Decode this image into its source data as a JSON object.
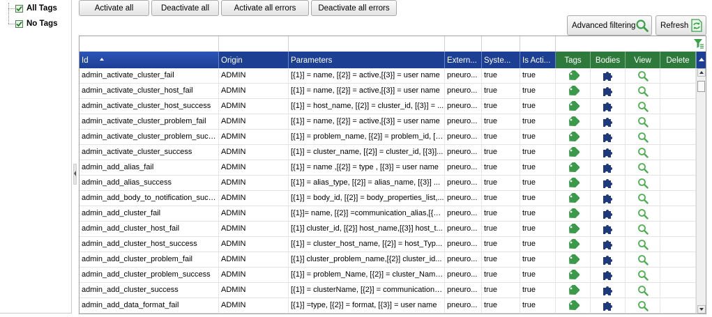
{
  "tree": {
    "items": [
      {
        "label": "All Tags",
        "checked": true
      },
      {
        "label": "No Tags",
        "checked": true
      }
    ]
  },
  "toolbar": {
    "activate_all": "Activate all",
    "deactivate_all": "Deactivate all",
    "activate_all_errors": "Activate all errors",
    "deactivate_all_errors": "Deactivate all errors",
    "advanced_filtering": "Advanced filtering",
    "refresh": "Refresh"
  },
  "grid": {
    "columns": {
      "id": "Id",
      "origin": "Origin",
      "parameters": "Parameters",
      "external": "Extern...",
      "system": "Syste...",
      "is_active": "Is Acti...",
      "tags": "Tags",
      "bodies": "Bodies",
      "view": "View",
      "delete": "Delete"
    },
    "sort_column": "id",
    "sort_direction": "ascending",
    "rows": [
      {
        "id": "admin_activate_cluster_fail",
        "origin": "ADMIN",
        "parameters": "[{1}] = name, [{2}] = active,[{3}] = user name",
        "external": "pneuro...",
        "system": "true",
        "active": "true"
      },
      {
        "id": "admin_activate_cluster_host_fail",
        "origin": "ADMIN",
        "parameters": "[{1}] = name, [{2}] = active,[{3}] = user name",
        "external": "pneuro...",
        "system": "true",
        "active": "true"
      },
      {
        "id": "admin_activate_cluster_host_success",
        "origin": "ADMIN",
        "parameters": "[{1}] = host_name, [{2}] = cluster_id, [{3}] = ...",
        "external": "pneuro...",
        "system": "true",
        "active": "true"
      },
      {
        "id": "admin_activate_cluster_problem_fail",
        "origin": "ADMIN",
        "parameters": "[{1}] = name, [{2}] = active,[{3}] = user name",
        "external": "pneuro...",
        "system": "true",
        "active": "true"
      },
      {
        "id": "admin_activate_cluster_problem_succ...",
        "origin": "ADMIN",
        "parameters": "[{1}] = problem_name, [{2}] = problem_id, [{...",
        "external": "pneuro...",
        "system": "true",
        "active": "true"
      },
      {
        "id": "admin_activate_cluster_success",
        "origin": "ADMIN",
        "parameters": "[{1}] = cluster_name, [{2}] = cluster_id, [{3}]...",
        "external": "pneuro...",
        "system": "true",
        "active": "true"
      },
      {
        "id": "admin_add_alias_fail",
        "origin": "ADMIN",
        "parameters": "[{1}] = name ,[{2}] = type , [{3}] =  user name",
        "external": "pneuro...",
        "system": "true",
        "active": "true"
      },
      {
        "id": "admin_add_alias_success",
        "origin": "ADMIN",
        "parameters": "[{1}] = alias_type, [{2}] = alias_name,  [{3}]  ...",
        "external": "pneuro...",
        "system": "true",
        "active": "true"
      },
      {
        "id": "admin_add_body_to_notification_succ...",
        "origin": "ADMIN",
        "parameters": "[{1}] = body_id, [{2}] = body_properties_list,...",
        "external": "pneuro...",
        "system": "true",
        "active": "true"
      },
      {
        "id": "admin_add_cluster_fail",
        "origin": "ADMIN",
        "parameters": "[{1}]= name, [{2}] =communication_alias,[{3}...",
        "external": "pneuro...",
        "system": "true",
        "active": "true"
      },
      {
        "id": "admin_add_cluster_host_fail",
        "origin": "ADMIN",
        "parameters": "[{1}] cluster_id, [{2}] host_name,[{3}] host_t...",
        "external": "pneuro...",
        "system": "true",
        "active": "true"
      },
      {
        "id": "admin_add_cluster_host_success",
        "origin": "ADMIN",
        "parameters": "[{1}] = cluster_host_name, [{2}] = host_Typ...",
        "external": "pneuro...",
        "system": "true",
        "active": "true"
      },
      {
        "id": "admin_add_cluster_problem_fail",
        "origin": "ADMIN",
        "parameters": "[{1}] cluster_problem_name,[{2}]  cluster_id...",
        "external": "pneuro...",
        "system": "true",
        "active": "true"
      },
      {
        "id": "admin_add_cluster_problem_success",
        "origin": "ADMIN",
        "parameters": "[{1}] = problem_Name, [{2}] = cluster_Name,...",
        "external": "pneuro...",
        "system": "true",
        "active": "true"
      },
      {
        "id": "admin_add_cluster_success",
        "origin": "ADMIN",
        "parameters": "[{1}] = clusterName, [{2}] = communication_...",
        "external": "pneuro...",
        "system": "true",
        "active": "true"
      },
      {
        "id": "admin_add_data_format_fail",
        "origin": "ADMIN",
        "parameters": "[{1}] =type, [{2}] = format, [{3}] = user name",
        "external": "pneuro...",
        "system": "true",
        "active": "true"
      }
    ]
  },
  "icons": {
    "tag": "tag-icon",
    "bodies": "puzzle-icon",
    "view": "magnifier-icon",
    "filter": "funnel-icon",
    "refresh": "refresh-icon"
  },
  "colors": {
    "header_blue": "#1c3f94",
    "header_green": "#2e7a3c",
    "tag_green": "#3a9a4a",
    "puzzle_navy": "#1e3a7a",
    "view_green": "#4caf50"
  }
}
